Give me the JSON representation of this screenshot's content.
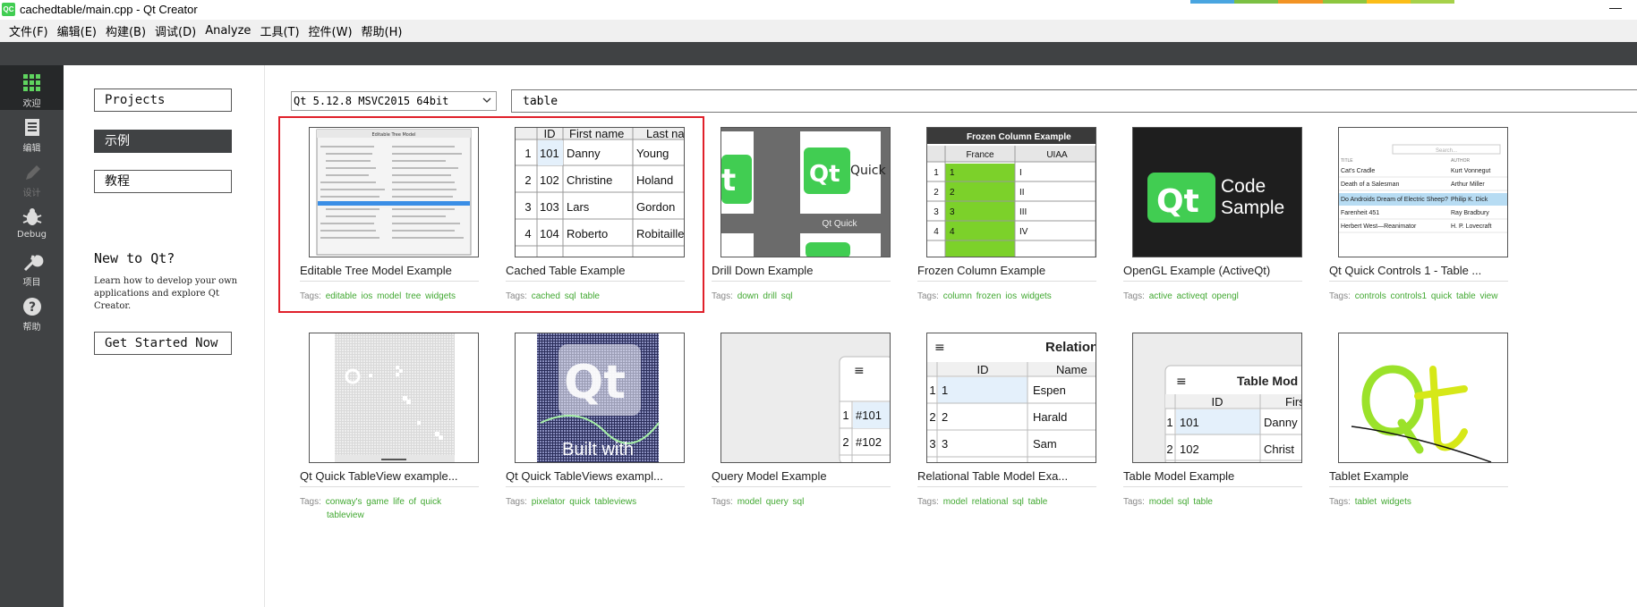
{
  "titlebar": {
    "app_icon": "QC",
    "title": "cachedtable/main.cpp - Qt Creator",
    "minimize": "—",
    "strip_colors": [
      "#49a5e0",
      "#7bc043",
      "#f29324",
      "#8dc63f",
      "#fbbd18",
      "#a6d14a"
    ]
  },
  "menu": [
    "文件(F)",
    "编辑(E)",
    "构建(B)",
    "调试(D)",
    "Analyze",
    "工具(T)",
    "控件(W)",
    "帮助(H)"
  ],
  "modes": [
    {
      "label": "欢迎",
      "icon": "grid-icon"
    },
    {
      "label": "编辑",
      "icon": "document-icon"
    },
    {
      "label": "设计",
      "icon": "pencil-icon"
    },
    {
      "label": "Debug",
      "icon": "bug-icon"
    },
    {
      "label": "项目",
      "icon": "wrench-icon"
    },
    {
      "label": "帮助",
      "icon": "help-icon"
    }
  ],
  "sidebar": {
    "projects": "Projects",
    "examples": "示例",
    "tutorials": "教程",
    "new_title": "New to Qt?",
    "new_text": "Learn how to develop your own applications and explore Qt Creator.",
    "get_started": "Get Started Now"
  },
  "filter": {
    "kit": "Qt 5.12.8 MSVC2015 64bit",
    "search": "table"
  },
  "examples": [
    {
      "name": "Editable Tree Model Example",
      "tags_label": "Tags:",
      "tags": [
        "editable",
        "ios",
        "model",
        "tree",
        "widgets"
      ]
    },
    {
      "name": "Cached Table Example",
      "tags_label": "Tags:",
      "tags": [
        "cached",
        "sql",
        "table"
      ]
    },
    {
      "name": "Drill Down Example",
      "tags_label": "Tags:",
      "tags": [
        "down",
        "drill",
        "sql"
      ]
    },
    {
      "name": "Frozen Column Example",
      "tags_label": "Tags:",
      "tags": [
        "column",
        "frozen",
        "ios",
        "widgets"
      ]
    },
    {
      "name": "OpenGL Example (ActiveQt)",
      "tags_label": "Tags:",
      "tags": [
        "active",
        "activeqt",
        "opengl"
      ]
    },
    {
      "name": "Qt Quick Controls 1 - Table ...",
      "tags_label": "Tags:",
      "tags": [
        "controls",
        "controls1",
        "quick",
        "table",
        "view"
      ]
    },
    {
      "name": "Qt Quick TableView example...",
      "tags_label": "Tags:",
      "tags": [
        "conway's",
        "game",
        "life",
        "of",
        "quick",
        "tableview"
      ]
    },
    {
      "name": "Qt Quick TableViews exampl...",
      "tags_label": "Tags:",
      "tags": [
        "pixelator",
        "quick",
        "tableviews"
      ]
    },
    {
      "name": "Query Model Example",
      "tags_label": "Tags:",
      "tags": [
        "model",
        "query",
        "sql"
      ]
    },
    {
      "name": "Relational Table Model Exa...",
      "tags_label": "Tags:",
      "tags": [
        "model",
        "relational",
        "sql",
        "table"
      ]
    },
    {
      "name": "Table Model Example",
      "tags_label": "Tags:",
      "tags": [
        "model",
        "sql",
        "table"
      ]
    },
    {
      "name": "Tablet Example",
      "tags_label": "Tags:",
      "tags": [
        "tablet",
        "widgets"
      ]
    }
  ],
  "thumbs": {
    "cached": {
      "headers": [
        "ID",
        "First name",
        "Last na"
      ],
      "rows": [
        [
          "1",
          "101",
          "Danny",
          "Young"
        ],
        [
          "2",
          "102",
          "Christine",
          "Holand"
        ],
        [
          "3",
          "103",
          "Lars",
          "Gordon"
        ],
        [
          "4",
          "104",
          "Roberto",
          "Robitaille"
        ]
      ]
    },
    "drill": {
      "logo": "Qt",
      "quick": "Quick",
      "caption": "Qt Quick"
    },
    "frozen": {
      "title": "Frozen Column Example",
      "headers": [
        "France",
        "UIAA"
      ],
      "rows": [
        [
          "1",
          "1",
          "I"
        ],
        [
          "2",
          "2",
          "II"
        ],
        [
          "3",
          "3",
          "III"
        ],
        [
          "4",
          "4",
          "IV"
        ]
      ]
    },
    "opengl": {
      "logo": "Qt",
      "line1": "Code",
      "line2": "Sample"
    },
    "quick1": {
      "search": "Search...",
      "col1": "TITLE",
      "col2": "AUTHOR",
      "rows": [
        [
          "Cat's Cradle",
          "Kurt Vonnegut"
        ],
        [
          "Death of a Salesman",
          "Arthur Miller"
        ],
        [
          "Do Androids Dream of Electric Sheep?",
          "Philip K. Dick"
        ],
        [
          "Farenheit 451",
          "Ray Bradbury"
        ],
        [
          "Herbert West—Reanimator",
          "H. P. Lovecraft"
        ]
      ]
    },
    "tableviews": {
      "caption": "Built with"
    },
    "query": {
      "rows": [
        [
          "1",
          "#101"
        ],
        [
          "2",
          "#102"
        ]
      ]
    },
    "relational": {
      "title": "Relation",
      "headers": [
        "ID",
        "Name"
      ],
      "rows": [
        [
          "1",
          "1",
          "Espen"
        ],
        [
          "2",
          "2",
          "Harald"
        ],
        [
          "3",
          "3",
          "Sam"
        ]
      ]
    },
    "tablemodel": {
      "title": "Table Mod",
      "headers": [
        "ID",
        "Firs"
      ],
      "rows": [
        [
          "1",
          "101",
          "Danny"
        ],
        [
          "2",
          "102",
          "Christ"
        ]
      ]
    },
    "tree": {
      "title": "Editable Tree Model"
    }
  }
}
